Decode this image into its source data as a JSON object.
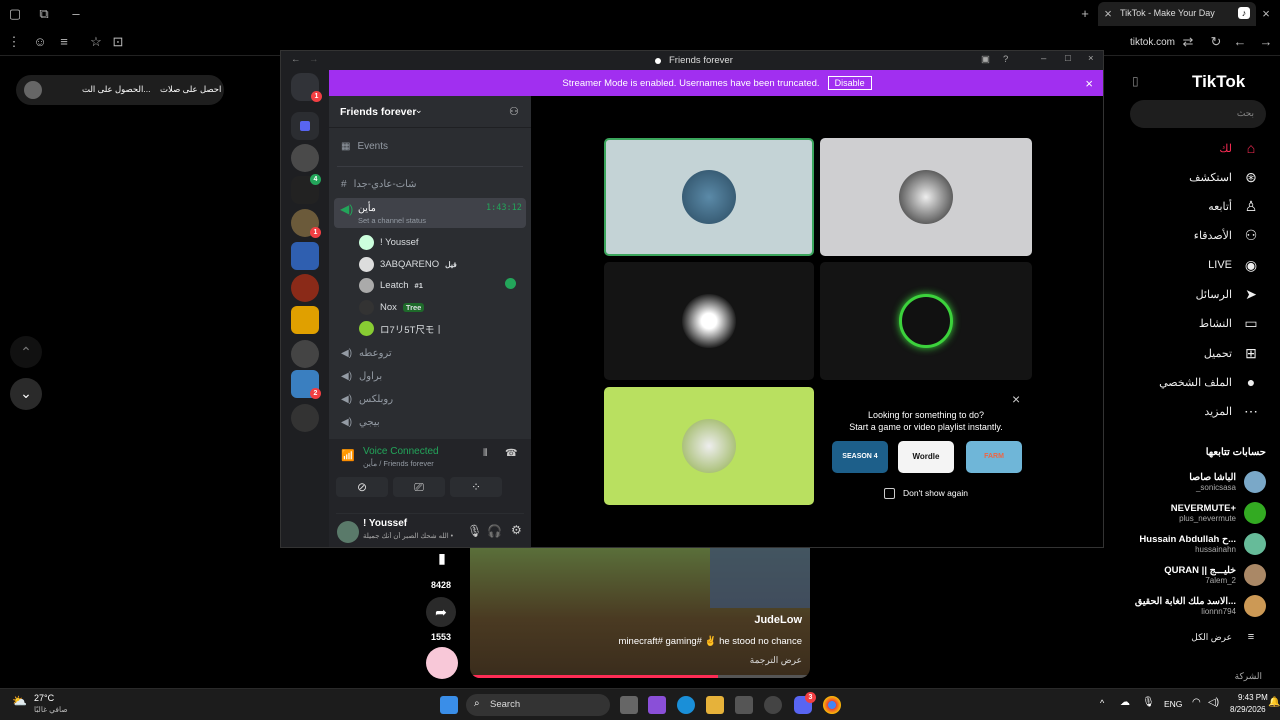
{
  "browser": {
    "tab_title": "TikTok - Make Your Day",
    "url": "tiktok.com"
  },
  "left_pill": {
    "a": "احصل على صلات",
    "b": "الحصول على الت..."
  },
  "tiktok": {
    "logo": "TikTok",
    "search_placeholder": "بحث",
    "nav": [
      {
        "label": "لك",
        "icon": "home-icon",
        "active": true
      },
      {
        "label": "استكشف",
        "icon": "compass-icon"
      },
      {
        "label": "أتابعه",
        "icon": "following-icon"
      },
      {
        "label": "الأصدقاء",
        "icon": "friends-icon"
      },
      {
        "label": "LIVE",
        "icon": "live-icon"
      },
      {
        "label": "الرسائل",
        "icon": "send-icon"
      },
      {
        "label": "النشاط",
        "icon": "activity-icon"
      },
      {
        "label": "تحميل",
        "icon": "upload-icon"
      },
      {
        "label": "الملف الشخصي",
        "icon": "profile-icon"
      },
      {
        "label": "المزيد",
        "icon": "more-icon"
      }
    ],
    "following_title": "حسابات تتابعها",
    "following": [
      {
        "name": "الباشا صاصا",
        "handle": "_sonicsasa"
      },
      {
        "name": "NEVERMUTE+",
        "handle": "plus_nevermute"
      },
      {
        "name": "Hussain Abdullah ح...",
        "handle": "hussainahn"
      },
      {
        "name": "QURAN || خليـــج",
        "handle": "7alem_2"
      },
      {
        "name": "الاسد ملك الغابة الحقيق...",
        "handle": "lionnn794"
      }
    ],
    "see_all": "عرض الكل",
    "company": "الشركة",
    "video": {
      "author": "JudeLow",
      "caption": "minecraft# gaming# ✌ he stood no chance",
      "translate": "عرض الترجمة",
      "bookmarks": "8428",
      "shares": "1553"
    }
  },
  "discord": {
    "window_title": "Friends forever",
    "banner_text": "Streamer Mode is enabled. Usernames have been truncated.",
    "banner_button": "Disable",
    "server_name": "Friends forever",
    "events": "Events",
    "text_channel": "شات-عادي-جدا",
    "voice_channel": "مأين",
    "timer": "1:43:12",
    "channel_status": "Set a channel status",
    "users": [
      {
        "name": "! Youssef",
        "tag": ""
      },
      {
        "name": "3ABQARENO",
        "tag": "فيل"
      },
      {
        "name": "Leatch",
        "tag": "#1"
      },
      {
        "name": "Nox",
        "tag": "Tree"
      },
      {
        "name": "ロ7リ5T尺モ丨",
        "tag": ""
      }
    ],
    "other_channels": [
      "تروعطه",
      "براول",
      "روبلكس",
      "بيجي"
    ],
    "voice_connected": "Voice Connected",
    "voice_sub": "مأين / Friends forever",
    "me_name": "! Youssef",
    "me_status": "الله شحك الصبر أن أنك جميلة •",
    "activity": {
      "line1": "Looking for something to do?",
      "line2": "Start a game or video playlist instantly.",
      "games": [
        "SEASON 4",
        "Wordle",
        "FARM"
      ],
      "dont_show": "Don't show again"
    }
  },
  "taskbar": {
    "weather_temp": "27°C",
    "weather_text": "صافي غالبًا",
    "search": "Search",
    "lang": "ENG",
    "time": "9:43 PM",
    "date": "8/29/2026",
    "discord_badge": "3"
  }
}
